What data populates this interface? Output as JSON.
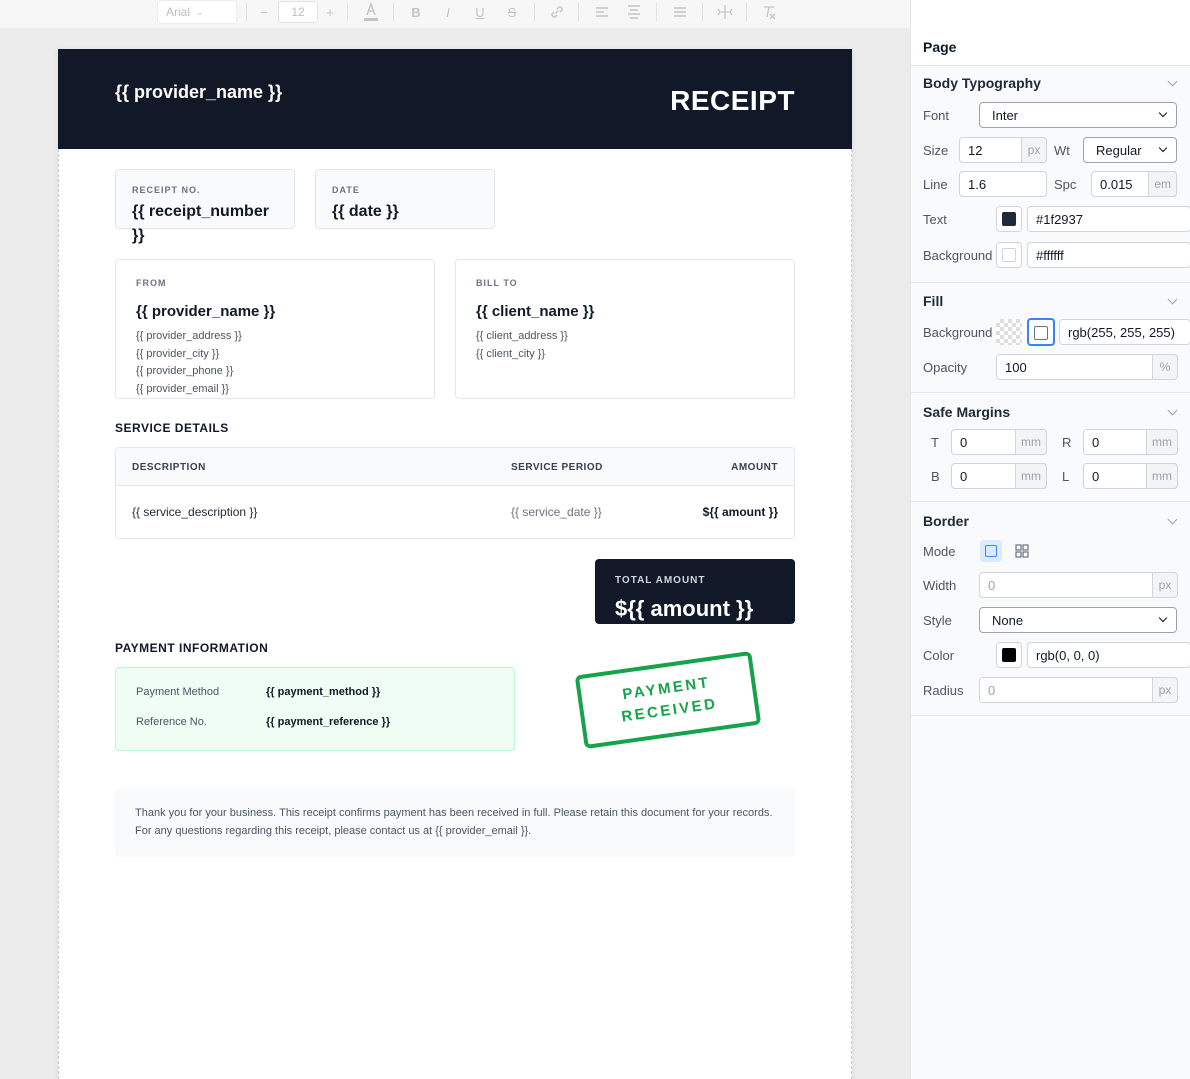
{
  "toolbar": {
    "font": "Arial",
    "font_size": "12",
    "minus": "−",
    "plus": "+"
  },
  "document": {
    "header": {
      "provider_name": "{{ provider_name }}",
      "title": "RECEIPT"
    },
    "receipt_no": {
      "label": "RECEIPT NO.",
      "value": "{{ receipt_number }}"
    },
    "date": {
      "label": "DATE",
      "value": "{{ date }}"
    },
    "from": {
      "label": "FROM",
      "name": "{{ provider_name }}",
      "lines": [
        "{{ provider_address }}",
        "{{ provider_city }}",
        "{{ provider_phone }}",
        "{{ provider_email }}"
      ]
    },
    "bill_to": {
      "label": "BILL TO",
      "name": "{{ client_name }}",
      "lines": [
        "{{ client_address }}",
        "{{ client_city }}"
      ]
    },
    "service": {
      "heading": "SERVICE DETAILS",
      "columns": [
        "DESCRIPTION",
        "SERVICE PERIOD",
        "AMOUNT"
      ],
      "row": {
        "description": "{{ service_description }}",
        "period": "{{ service_date }}",
        "amount": "${{ amount }}"
      }
    },
    "total": {
      "label": "TOTAL AMOUNT",
      "value": "${{ amount }}"
    },
    "payment": {
      "heading": "PAYMENT INFORMATION",
      "method_label": "Payment Method",
      "method_value": "{{ payment_method }}",
      "reference_label": "Reference No.",
      "reference_value": "{{ payment_reference }}"
    },
    "stamp": {
      "line1": "PAYMENT",
      "line2": "RECEIVED",
      "color": "#16a34a"
    },
    "footer": "Thank you for your business. This receipt confirms payment has been received in full. Please retain this document for your records. For any questions regarding this receipt, please contact us at {{ provider_email }}."
  },
  "panel": {
    "title": "Page",
    "typography": {
      "title": "Body Typography",
      "font_label": "Font",
      "font_value": "Inter",
      "size_label": "Size",
      "size_value": "12",
      "size_unit": "px",
      "weight_label": "Wt",
      "weight_value": "Regular",
      "line_label": "Line",
      "line_value": "1.6",
      "spacing_label": "Spc",
      "spacing_value": "0.015",
      "spacing_unit": "em",
      "text_label": "Text",
      "text_color": "#1f2937",
      "bg_label": "Background",
      "bg_color": "#ffffff"
    },
    "fill": {
      "title": "Fill",
      "bg_label": "Background",
      "bg_value": "rgb(255, 255, 255)",
      "opacity_label": "Opacity",
      "opacity_value": "100",
      "opacity_unit": "%"
    },
    "margins": {
      "title": "Safe Margins",
      "t_label": "T",
      "t_value": "0",
      "r_label": "R",
      "r_value": "0",
      "b_label": "B",
      "b_value": "0",
      "l_label": "L",
      "l_value": "0",
      "unit": "mm"
    },
    "border": {
      "title": "Border",
      "mode_label": "Mode",
      "width_label": "Width",
      "width_value": "0",
      "width_unit": "px",
      "style_label": "Style",
      "style_value": "None",
      "color_label": "Color",
      "color_value": "rgb(0, 0, 0)",
      "radius_label": "Radius",
      "radius_value": "0",
      "radius_unit": "px"
    }
  },
  "colors": {
    "dark": "#111827",
    "accent": "#3b82f6",
    "stamp_green": "#16a34a"
  }
}
